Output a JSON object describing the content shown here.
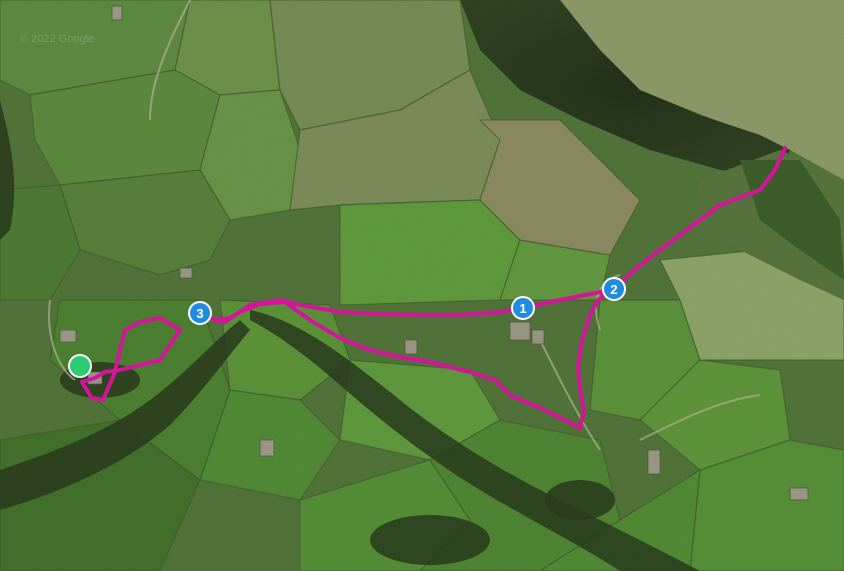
{
  "map": {
    "type": "satellite",
    "route_color": "#d4149a",
    "start_marker_color": "#2ecc71",
    "waypoint_color": "#1f8ce0",
    "watermark": "© 2022 Google"
  },
  "waypoints": [
    {
      "id": "wp1",
      "label": "1"
    },
    {
      "id": "wp2",
      "label": "2"
    },
    {
      "id": "wp3",
      "label": "3"
    }
  ]
}
